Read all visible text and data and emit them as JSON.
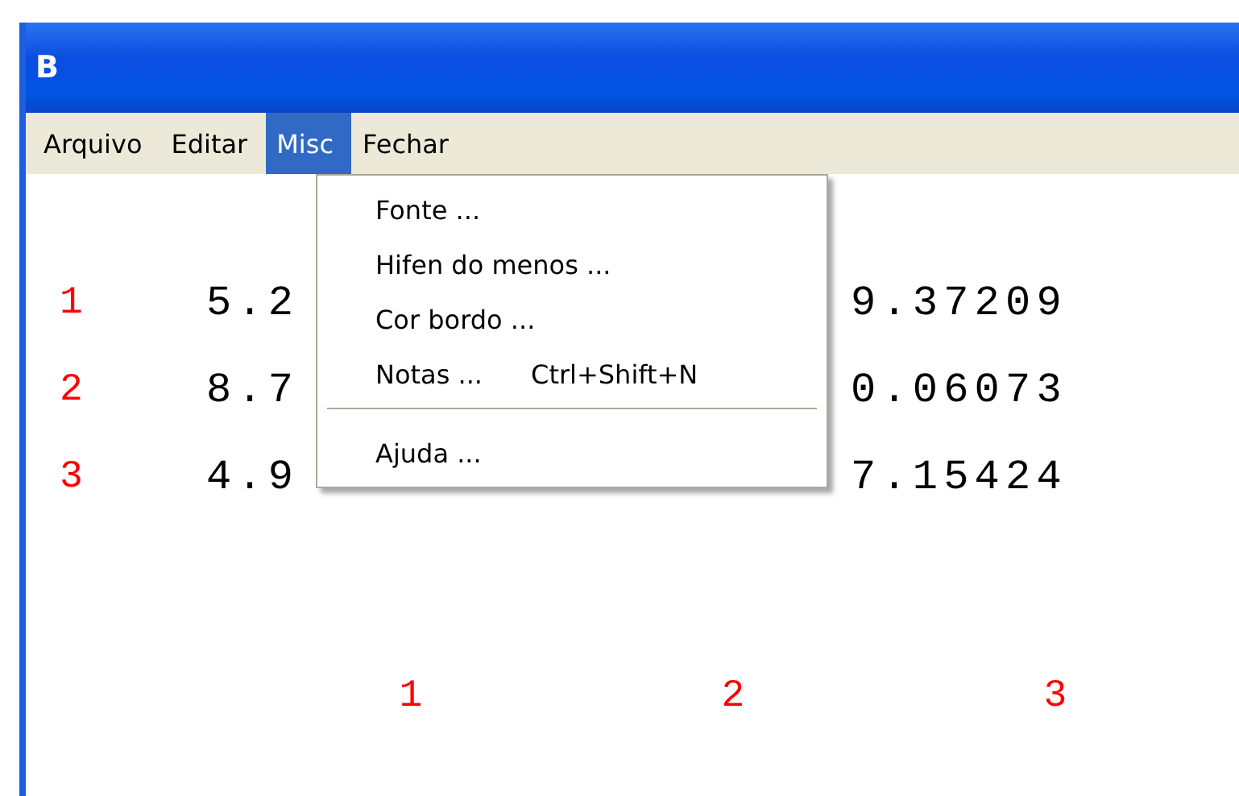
{
  "window": {
    "title": "B"
  },
  "menu_bar": [
    {
      "label": "Arquivo",
      "selected": false
    },
    {
      "label": "Editar",
      "selected": false
    },
    {
      "label": "Misc",
      "selected": true
    },
    {
      "label": "Fechar",
      "selected": false
    }
  ],
  "dropdown": {
    "items": [
      {
        "kind": "item",
        "label": "Fonte ..."
      },
      {
        "kind": "item",
        "label": "Hifen do menos ..."
      },
      {
        "kind": "item",
        "label": "Cor bordo ..."
      },
      {
        "kind": "item",
        "label": "Notas ...",
        "shortcut": "Ctrl+Shift+N"
      },
      {
        "kind": "separator"
      },
      {
        "kind": "item",
        "label": "Ajuda ..."
      }
    ]
  },
  "grid": {
    "rows": [
      {
        "label": "1",
        "column_1": "5.2",
        "column_3": "9.37209"
      },
      {
        "label": "2",
        "column_1": "8.7",
        "column_3": "0.06073"
      },
      {
        "label": "3",
        "column_1": "4.9",
        "column_3": "7.15424"
      }
    ],
    "column_labels": [
      "1",
      "2",
      "3"
    ]
  }
}
